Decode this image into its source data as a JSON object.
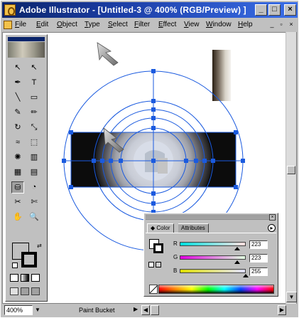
{
  "window": {
    "title": "Adobe Illustrator - [Untitled-3 @ 400% (RGB/Preview) ]",
    "minimize_glyph": "_",
    "maximize_glyph": "□",
    "close_glyph": "×"
  },
  "menubar": {
    "items": [
      "File",
      "Edit",
      "Object",
      "Type",
      "Select",
      "Filter",
      "Effect",
      "View",
      "Window",
      "Help"
    ],
    "doc_minimize_glyph": "_",
    "doc_restore_glyph": "▫",
    "doc_close_glyph": "×"
  },
  "toolbox": {
    "tools": [
      {
        "name": "selection-tool",
        "glyph": "↖"
      },
      {
        "name": "direct-selection-tool",
        "glyph": "↖"
      },
      {
        "name": "pen-tool",
        "glyph": "✒"
      },
      {
        "name": "type-tool",
        "glyph": "T"
      },
      {
        "name": "line-tool",
        "glyph": "╲"
      },
      {
        "name": "rectangle-tool",
        "glyph": "▭"
      },
      {
        "name": "paintbrush-tool",
        "glyph": "✎"
      },
      {
        "name": "pencil-tool",
        "glyph": "✏"
      },
      {
        "name": "rotate-tool",
        "glyph": "↻"
      },
      {
        "name": "scale-tool",
        "glyph": "⤡"
      },
      {
        "name": "warp-tool",
        "glyph": "≈"
      },
      {
        "name": "free-transform-tool",
        "glyph": "⬚"
      },
      {
        "name": "symbol-sprayer-tool",
        "glyph": "✺"
      },
      {
        "name": "graph-tool",
        "glyph": "▥"
      },
      {
        "name": "mesh-tool",
        "glyph": "▦"
      },
      {
        "name": "gradient-tool",
        "glyph": "▤"
      },
      {
        "name": "paint-bucket-tool",
        "glyph": "⛁"
      },
      {
        "name": "blend-tool",
        "glyph": "◔"
      },
      {
        "name": "slice-tool",
        "glyph": "✂"
      },
      {
        "name": "scissors-tool",
        "glyph": "✄"
      },
      {
        "name": "hand-tool",
        "glyph": "✋"
      },
      {
        "name": "zoom-tool",
        "glyph": "🔍"
      }
    ],
    "fill_color": "#ffffff",
    "stroke_color": "#000000"
  },
  "color_panel": {
    "tabs": [
      "Color",
      "Attributes"
    ],
    "close_glyph": "×",
    "menu_glyph": "▸",
    "sliders": [
      {
        "label": "R",
        "value": "223",
        "gradient": [
          "#00e0e0",
          "#ffe0e0"
        ],
        "thumb": 0.87
      },
      {
        "label": "G",
        "value": "223",
        "gradient": [
          "#df00df",
          "#dfffdf"
        ],
        "thumb": 0.87
      },
      {
        "label": "B",
        "value": "255",
        "gradient": [
          "#dfdf00",
          "#dfdfff"
        ],
        "thumb": 1.0
      }
    ]
  },
  "status": {
    "zoom": "400%",
    "current_tool": "Paint Bucket"
  },
  "canvas": {
    "guide_color": "#1a5adf"
  }
}
